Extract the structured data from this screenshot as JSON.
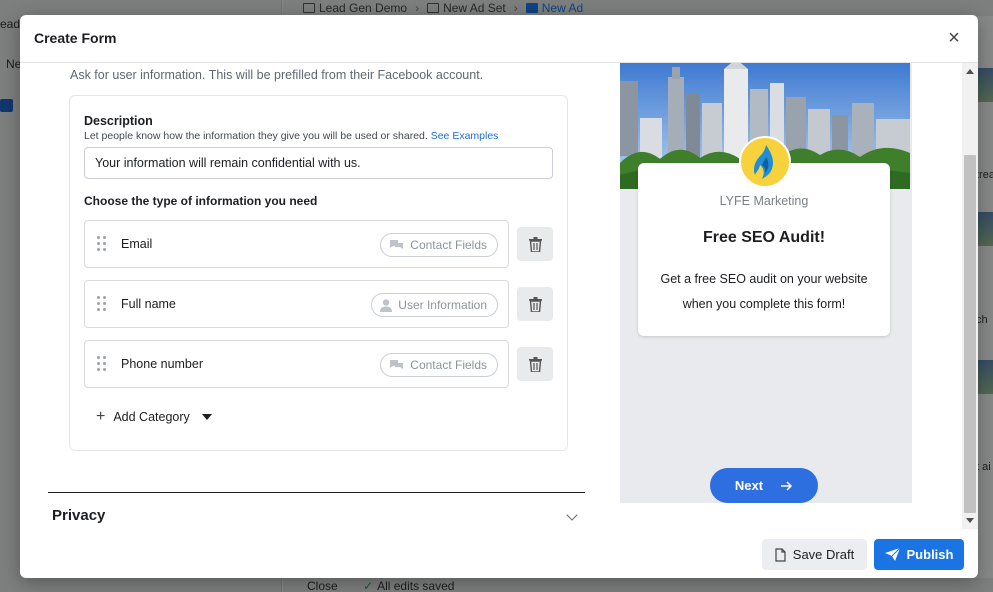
{
  "background": {
    "left_panel_texts": [
      "ead",
      "Ne"
    ],
    "breadcrumbs": [
      "Lead Gen Demo",
      "New Ad Set",
      "New Ad"
    ],
    "right_texts": [
      "trea",
      "ch",
      "t ai"
    ],
    "bottom": {
      "close_label": "Close",
      "saved_label": "All edits saved"
    }
  },
  "modal": {
    "title": "Create Form",
    "intro": "Ask for user information. This will be prefilled from their Facebook account.",
    "description": {
      "label": "Description",
      "help": "Let people know how the information they give you will be used or shared.",
      "help_link": "See Examples",
      "value": "Your information will remain confidential with us."
    },
    "choose_label": "Choose the type of information you need",
    "fields": [
      {
        "label": "Email",
        "category": "Contact Fields",
        "category_icon": "chat-bubbles-icon"
      },
      {
        "label": "Full name",
        "category": "User Information",
        "category_icon": "person-icon"
      },
      {
        "label": "Phone number",
        "category": "Contact Fields",
        "category_icon": "chat-bubbles-icon"
      }
    ],
    "add_category_label": "Add Category",
    "privacy_label": "Privacy",
    "preview": {
      "brand": "LYFE Marketing",
      "headline": "Free SEO Audit!",
      "body": "Get a free SEO audit on your website when you complete this form!",
      "next_label": "Next"
    },
    "footer": {
      "save_draft_label": "Save Draft",
      "publish_label": "Publish"
    }
  },
  "colors": {
    "primary": "#1b74e4",
    "next_button": "#2d6fe0",
    "logo_bg": "#f7d23c",
    "link": "#216fdb"
  }
}
